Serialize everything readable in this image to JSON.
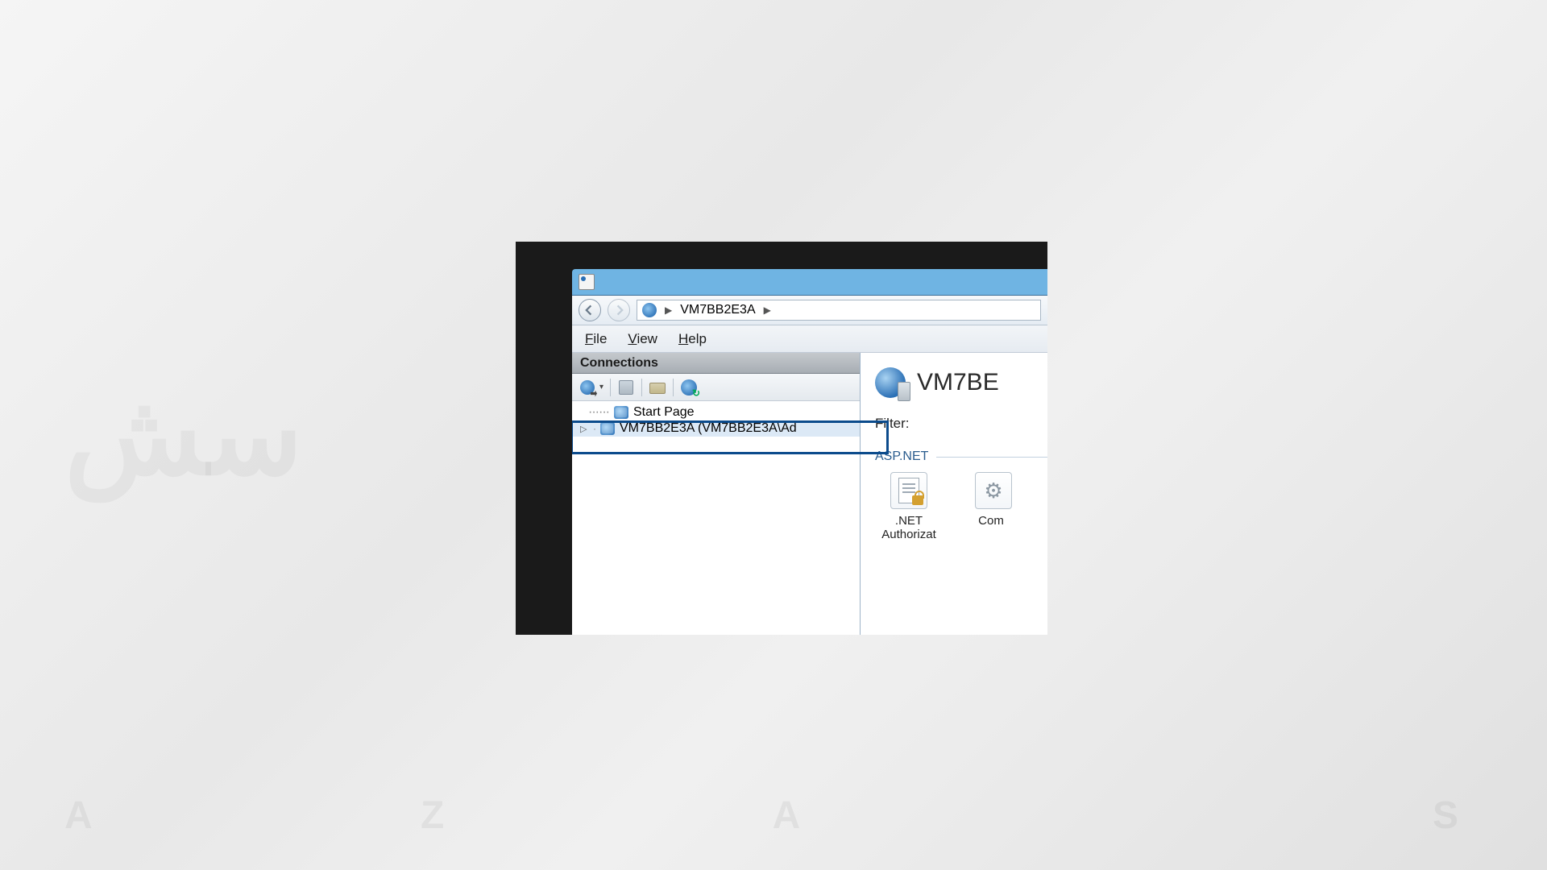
{
  "breadcrumb": {
    "server": "VM7BB2E3A"
  },
  "menubar": {
    "file": "File",
    "view": "View",
    "help": "Help"
  },
  "connections": {
    "header": "Connections",
    "start_page": "Start Page",
    "server_node": "VM7BB2E3A (VM7BB2E3A\\Ad"
  },
  "content": {
    "title": "VM7BE",
    "filter_label": "Filter:",
    "section_aspnet": "ASP.NET",
    "features": {
      "net_auth": ".NET Authorizat",
      "com": "Com"
    }
  }
}
